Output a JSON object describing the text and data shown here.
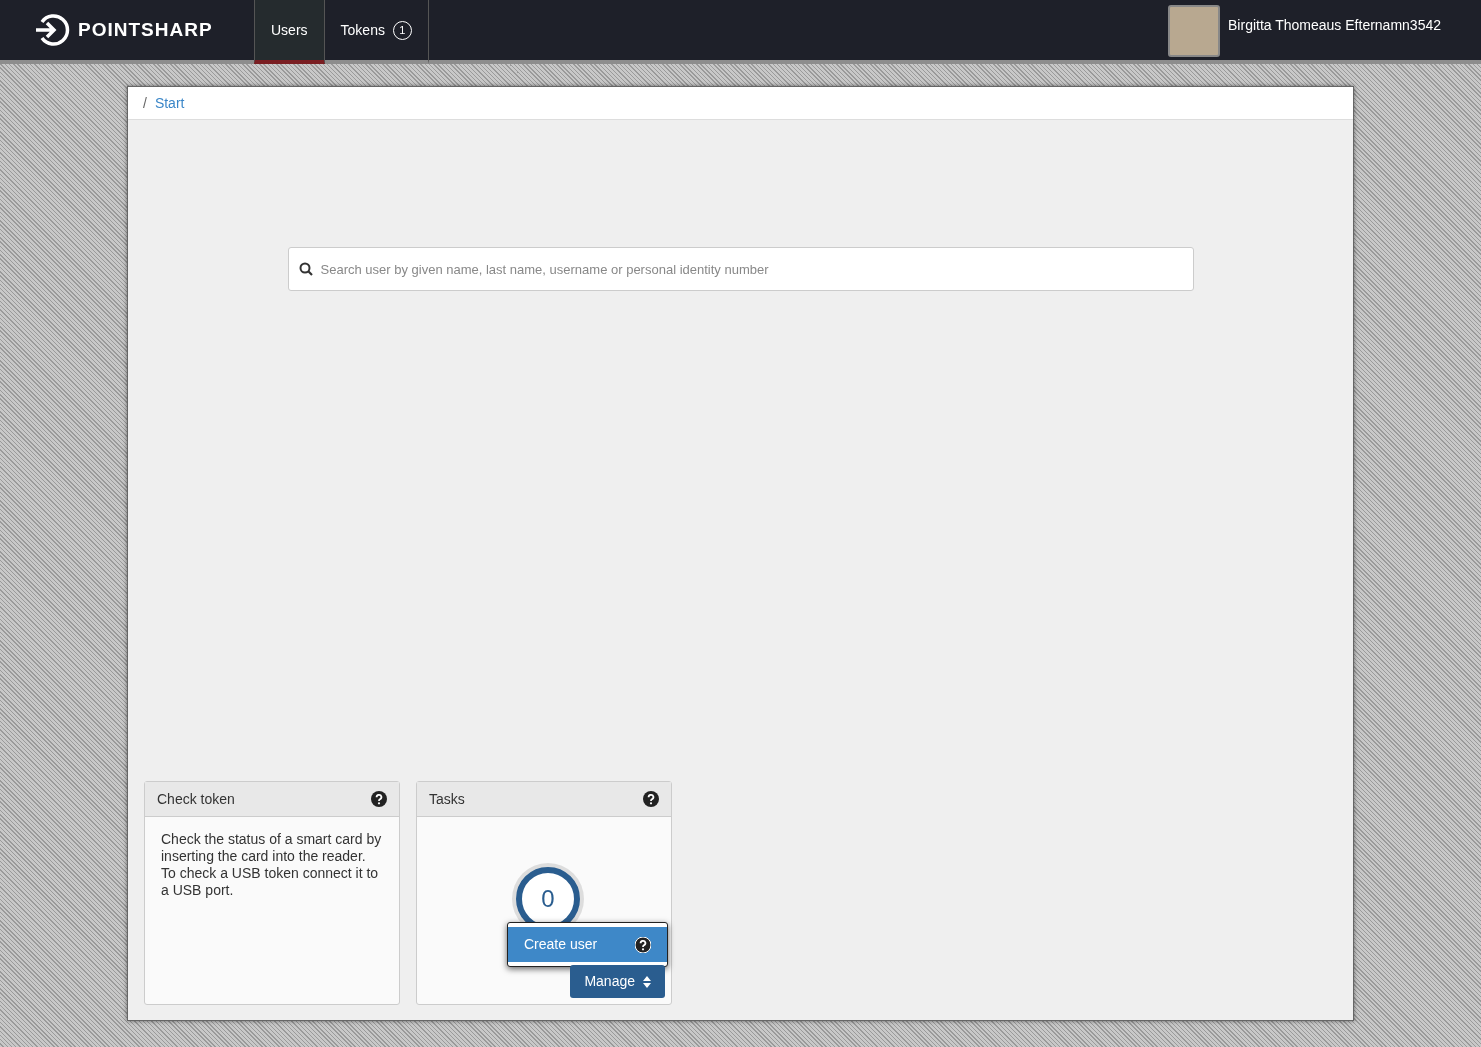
{
  "header": {
    "logo": "POINTSHARP",
    "tabs": [
      {
        "label": "Users",
        "selected": true
      },
      {
        "label": "Tokens",
        "badge": "1",
        "selected": false
      }
    ],
    "user": {
      "name": "Birgitta Thomeaus Efternamn3542"
    }
  },
  "breadcrumb": {
    "separator": "/",
    "items": [
      {
        "label": "Start"
      }
    ]
  },
  "search": {
    "placeholder": "Search user by given name, last name, username or personal identity number"
  },
  "widgets": [
    {
      "kind": "text",
      "title": "Check token",
      "body": "Check the status of a smart card by inserting the card into the reader. To check a USB token connect it to a USB port."
    },
    {
      "kind": "tasks",
      "title": "Tasks",
      "count": "0",
      "menu": [
        {
          "label": "Create user",
          "selected": true
        }
      ],
      "button": "Manage"
    }
  ]
}
